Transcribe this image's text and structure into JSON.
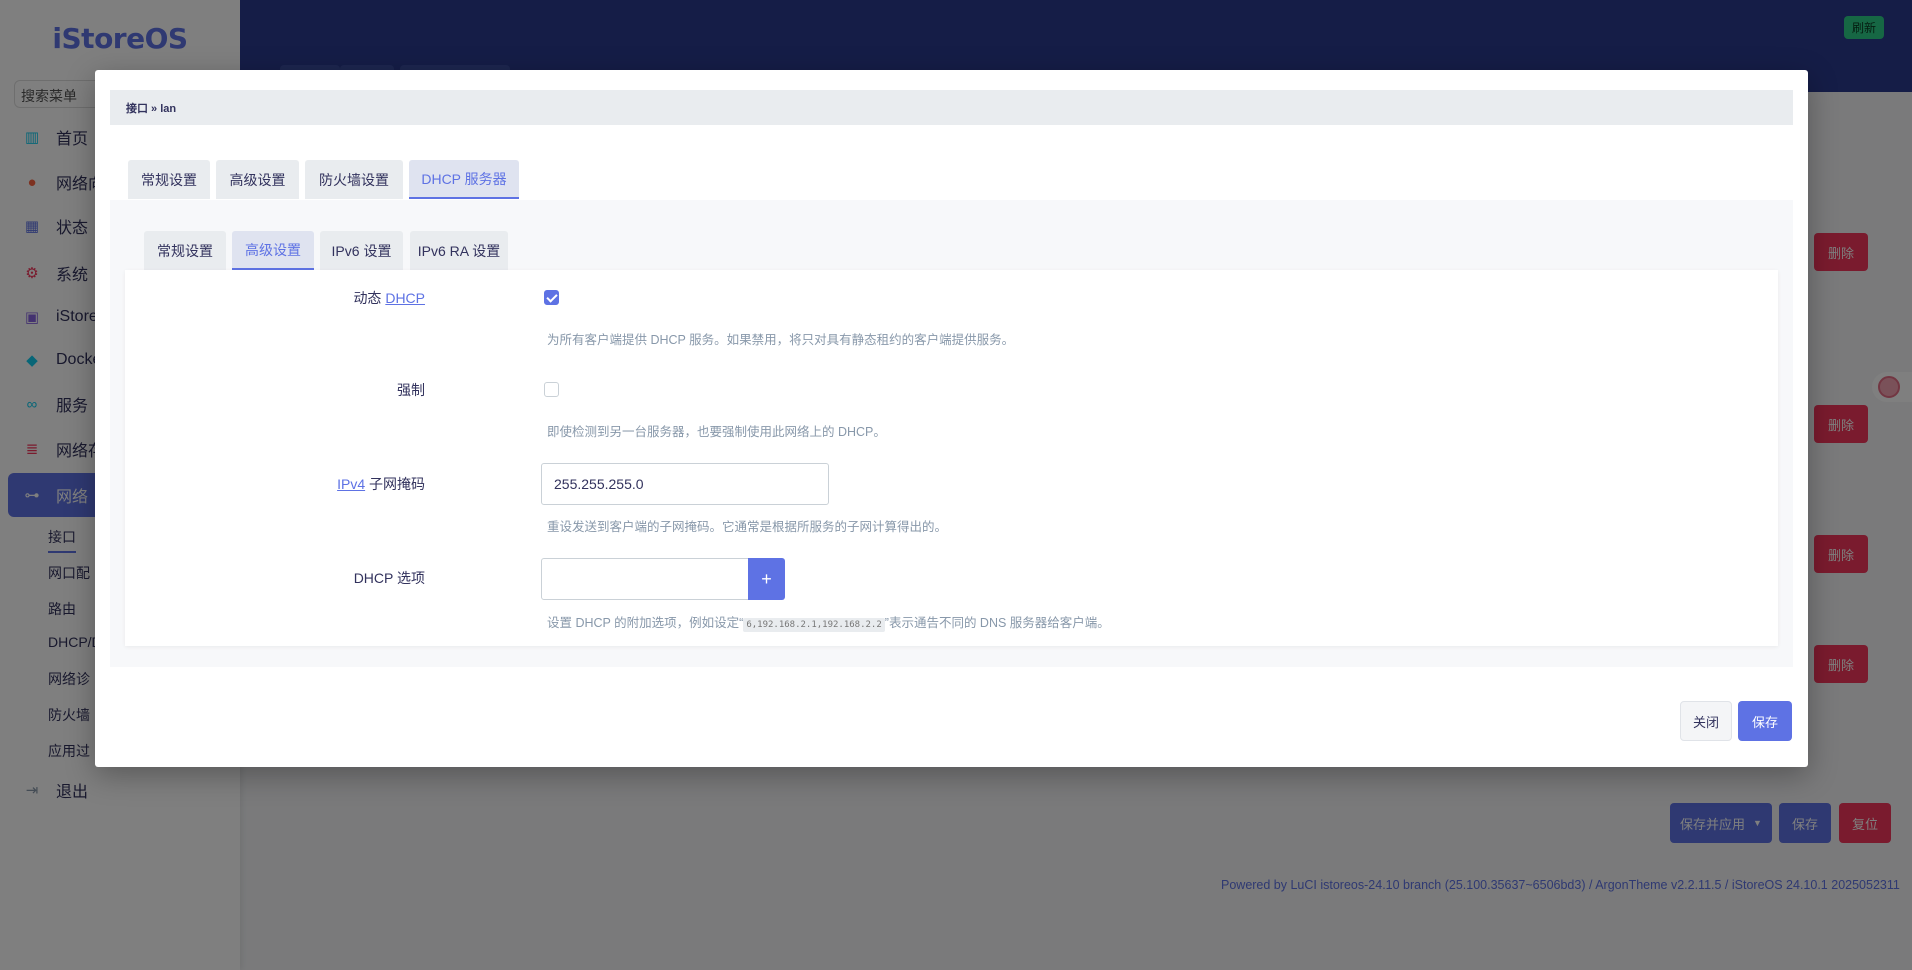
{
  "app": {
    "brand": "iStoreOS",
    "search_placeholder": "搜索菜单"
  },
  "sidebar": {
    "items": [
      {
        "label": "首页",
        "icon": "dashboard-icon"
      },
      {
        "label": "网络向",
        "icon": "compass-icon"
      },
      {
        "label": "状态",
        "icon": "grid-icon"
      },
      {
        "label": "系统",
        "icon": "gear-icon"
      },
      {
        "label": "iStore",
        "icon": "store-icon"
      },
      {
        "label": "Docke",
        "icon": "docker-icon"
      },
      {
        "label": "服务",
        "icon": "link-icon"
      },
      {
        "label": "网络存",
        "icon": "database-icon"
      },
      {
        "label": "网络",
        "icon": "network-icon"
      }
    ],
    "sub_items": [
      "接口",
      "网口配",
      "路由",
      "DHCP/D",
      "网络诊",
      "防火墙",
      "应用过"
    ],
    "logout": "退出"
  },
  "header": {
    "refresh": "刷新"
  },
  "background": {
    "delete_label": "删除",
    "save_apply": "保存并应用",
    "save": "保存",
    "reset": "复位",
    "footer": "Powered by LuCI istoreos-24.10 branch (25.100.35637~6506bd3) / ArgonTheme v2.2.11.5 / iStoreOS 24.10.1 2025052311"
  },
  "modal": {
    "breadcrumb": "接口 » lan",
    "tabs": [
      "常规设置",
      "高级设置",
      "防火墙设置",
      "DHCP 服务器"
    ],
    "active_tab": "DHCP 服务器",
    "subtabs": [
      "常规设置",
      "高级设置",
      "IPv6 设置",
      "IPv6 RA 设置"
    ],
    "active_subtab": "高级设置",
    "fields": {
      "dynamic_dhcp": {
        "label_prefix": "动态",
        "label_abbr": "DHCP",
        "checked": true,
        "help": "为所有客户端提供 DHCP 服务。如果禁用，将只对具有静态租约的客户端提供服务。"
      },
      "force": {
        "label": "强制",
        "checked": false,
        "help": "即使检测到另一台服务器，也要强制使用此网络上的 DHCP。"
      },
      "netmask": {
        "label_abbr": "IPv4",
        "label_suffix": "子网掩码",
        "value": "255.255.255.0",
        "help": "重设发送到客户端的子网掩码。它通常是根据所服务的子网计算得出的。"
      },
      "dhcp_options": {
        "label": "DHCP 选项",
        "value": "",
        "add": "+",
        "help_prefix": "设置 DHCP 的附加选项，例如设定“",
        "help_code": "6,192.168.2.1,192.168.2.2",
        "help_suffix": "”表示通告不同的 DNS 服务器给客户端。"
      }
    },
    "close": "关闭",
    "save": "保存"
  },
  "colors": {
    "accent": "#5e72e4",
    "topbar": "#2a3a8e",
    "danger": "#f5365c",
    "success": "#2dce89"
  }
}
